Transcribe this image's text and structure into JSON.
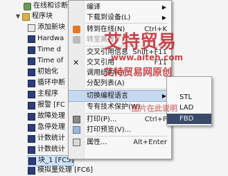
{
  "tree": {
    "online_diag": "在线和诊断",
    "program_blocks": "程序块",
    "items": [
      {
        "label": "添加新块"
      },
      {
        "label": "Hardwa"
      },
      {
        "label": "Time d"
      },
      {
        "label": "Time of"
      },
      {
        "label": "初始化"
      },
      {
        "label": "循环中断"
      },
      {
        "label": "主程序"
      },
      {
        "label": "报警 [FC"
      },
      {
        "label": "故障处理"
      },
      {
        "label": "急停处理"
      },
      {
        "label": "计数统计"
      },
      {
        "label": "计数统计"
      },
      {
        "label": "块_1 [FC5]"
      },
      {
        "label": "模拟量处理 [FC6]"
      }
    ]
  },
  "context_menu": {
    "items": [
      {
        "label": "编译",
        "key": "",
        "submenu": true
      },
      {
        "label": "下载到设备(L)",
        "key": "",
        "submenu": true
      },
      {
        "label": "转到在线(N)",
        "key": "Ctrl+K"
      },
      {
        "label": "转至离线(F)",
        "key": "",
        "disabled": true
      },
      {
        "label": "交叉引用信息",
        "key": "Shift+F11"
      },
      {
        "label": "交叉引用",
        "key": "F11"
      },
      {
        "label": "调用结构(C)",
        "key": ""
      },
      {
        "label": "分配列表(A)",
        "key": ""
      },
      {
        "label": "切换编程语言",
        "key": "",
        "submenu": true,
        "highlighted": true
      },
      {
        "label": "专有技术保护(W)",
        "key": ""
      },
      {
        "label": "打印(P)...",
        "key": "Ctrl+P"
      },
      {
        "label": "打印预览(V)...",
        "key": ""
      },
      {
        "label": "属性...",
        "key": "Alt+Enter"
      }
    ]
  },
  "submenu": {
    "items": [
      {
        "label": "STL"
      },
      {
        "label": "LAD"
      },
      {
        "label": "FBD",
        "highlighted": true
      }
    ]
  },
  "watermark": {
    "line1": "艾特贸易",
    "line2": "www.aiteh.com",
    "line3": "艾特贸易网原创",
    "line4": "图片在此说明"
  },
  "colors": {
    "accent": "#c7d9ef",
    "watermark_red": "#c0282c"
  }
}
